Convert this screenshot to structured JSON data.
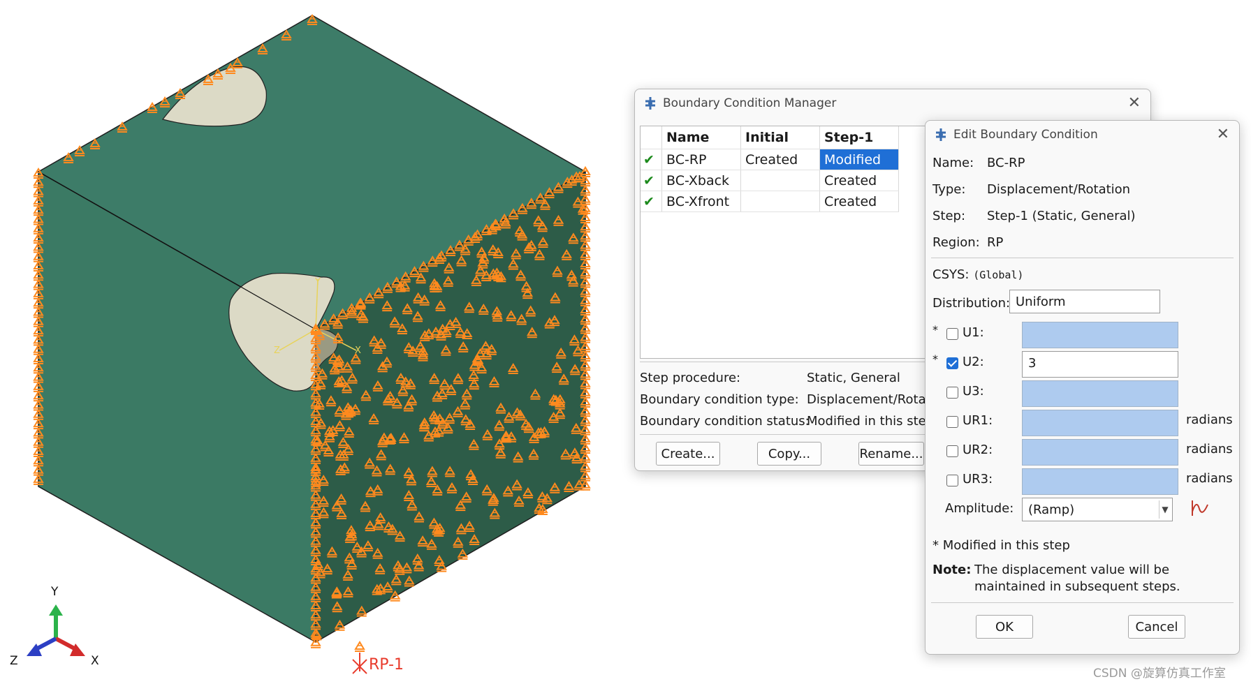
{
  "viewport": {
    "triad_labels": {
      "y": "Y",
      "z": "Z",
      "x": "X"
    },
    "ref_point_label": "RP-1",
    "csys_labels": {
      "y": "Y",
      "z": "Z",
      "x": "X"
    },
    "colors": {
      "face_top": "#3d7c68",
      "face_left": "#3b7a64",
      "face_right": "#2d5c48",
      "cutout": "#dcdac6",
      "bc_symbol": "#ff8a1e",
      "rp_color": "#e83b2c"
    }
  },
  "bc_manager": {
    "title": "Boundary Condition Manager",
    "columns": [
      "Name",
      "Initial",
      "Step-1"
    ],
    "rows": [
      {
        "checked": "✔",
        "name": "BC-RP",
        "initial": "Created",
        "step1": "Modified",
        "selected": true
      },
      {
        "checked": "✔",
        "name": "BC-Xback",
        "initial": "",
        "step1": "Created",
        "selected": false
      },
      {
        "checked": "✔",
        "name": "BC-Xfront",
        "initial": "",
        "step1": "Created",
        "selected": false
      }
    ],
    "info": {
      "procedure_label": "Step procedure:",
      "procedure_value": "Static, General",
      "type_label": "Boundary condition type:",
      "type_value": "Displacement/Rotat",
      "status_label": "Boundary condition status:",
      "status_value": "Modified in this ste"
    },
    "buttons": {
      "create": "Create...",
      "copy": "Copy...",
      "rename": "Rename..."
    }
  },
  "edit_bc": {
    "title": "Edit Boundary Condition",
    "name_label": "Name:",
    "name_value": "BC-RP",
    "type_label": "Type:",
    "type_value": "Displacement/Rotation",
    "step_label": "Step:",
    "step_value": "Step-1 (Static, General)",
    "region_label": "Region:",
    "region_value": "RP",
    "csys_label": "CSYS:",
    "csys_value": "(Global)",
    "distribution_label": "Distribution:",
    "distribution_value": "Uniform",
    "dofs": [
      {
        "label": "U1:",
        "checked": false,
        "value": "",
        "modified": "*",
        "unit": ""
      },
      {
        "label": "U2:",
        "checked": true,
        "value": "3",
        "modified": "*",
        "unit": ""
      },
      {
        "label": "U3:",
        "checked": false,
        "value": "",
        "modified": "",
        "unit": ""
      },
      {
        "label": "UR1:",
        "checked": false,
        "value": "",
        "modified": "",
        "unit": "radians"
      },
      {
        "label": "UR2:",
        "checked": false,
        "value": "",
        "modified": "",
        "unit": "radians"
      },
      {
        "label": "UR3:",
        "checked": false,
        "value": "",
        "modified": "",
        "unit": "radians"
      }
    ],
    "amplitude_label": "Amplitude:",
    "amplitude_value": "(Ramp)",
    "modified_note": "* Modified in this step",
    "note_label": "Note:",
    "note_line1": "The displacement value will be",
    "note_line2": "maintained in subsequent steps.",
    "ok": "OK",
    "cancel": "Cancel"
  },
  "watermark": "CSDN @旋算仿真工作室"
}
